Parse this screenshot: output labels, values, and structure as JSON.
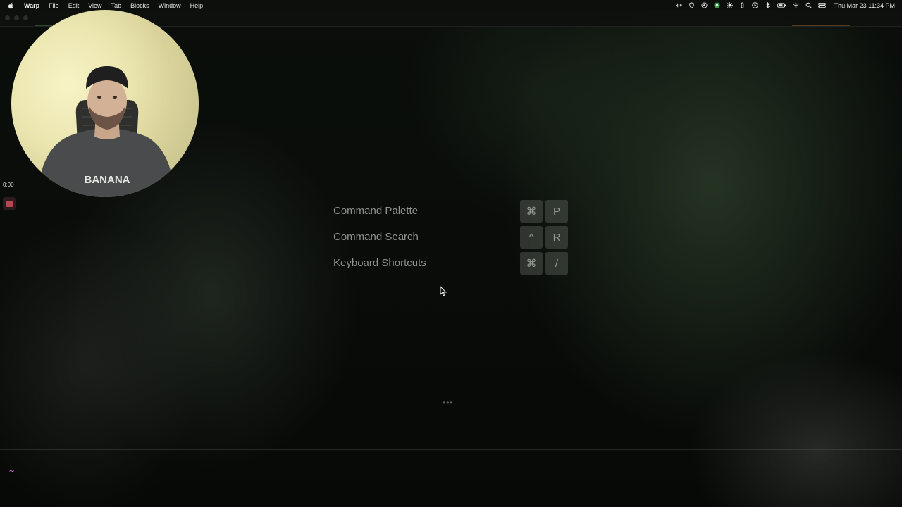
{
  "menubar": {
    "app_name": "Warp",
    "menus": [
      "File",
      "Edit",
      "View",
      "Tab",
      "Blocks",
      "Window",
      "Help"
    ],
    "clock": "Thu Mar 23  11:34 PM",
    "status_icons": [
      "waveform-icon",
      "shield-icon",
      "hat-icon",
      "chrome-icon",
      "sun-icon",
      "pen-icon",
      "play-icon",
      "bluetooth-icon",
      "battery-icon",
      "wifi-icon",
      "search-icon",
      "control-center-icon"
    ]
  },
  "recording": {
    "timer": "0:00",
    "shirt_text": "BANANA"
  },
  "shortcuts": [
    {
      "label": "Command Palette",
      "keys": [
        "⌘",
        "P"
      ]
    },
    {
      "label": "Command Search",
      "keys": [
        "^",
        "R"
      ]
    },
    {
      "label": "Keyboard Shortcuts",
      "keys": [
        "⌘",
        "/"
      ]
    }
  ],
  "loading_dots": "•••",
  "terminal": {
    "prompt": "~"
  },
  "colors": {
    "prompt": "#d26bd9",
    "stop_button": "#b4474f",
    "label_text": "#8d938c"
  }
}
